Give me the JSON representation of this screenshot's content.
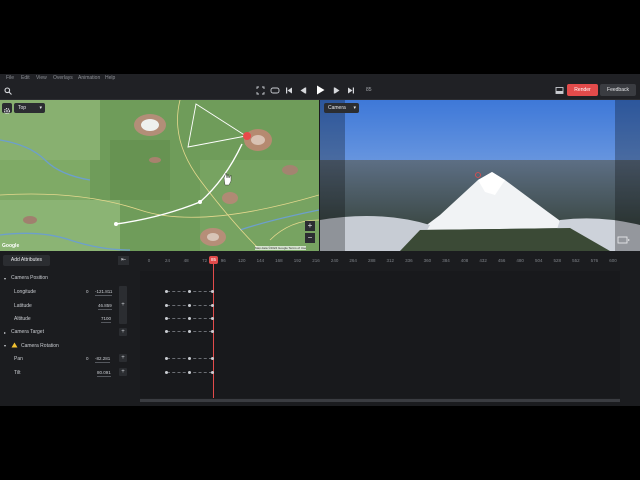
{
  "menu": [
    "File",
    "Edit",
    "View",
    "Overlays",
    "Animation",
    "Help"
  ],
  "toolbar": {
    "frame_counter": "85",
    "render_label": "Render",
    "feedback_label": "Feedback"
  },
  "map_view": {
    "dropdown_label": "Top",
    "attribution": "Map data ©2024 Google  Terms of Use",
    "google_logo": "Google",
    "zoom_in": "+",
    "zoom_out": "−"
  },
  "camera_view": {
    "dropdown_label": "Camera"
  },
  "timeline": {
    "add_attributes_label": "Add Attributes",
    "ruler_ticks": [
      "0",
      "24",
      "48",
      "72",
      "96",
      "120",
      "144",
      "168",
      "192",
      "216",
      "240",
      "264",
      "288",
      "312",
      "336",
      "360",
      "384",
      "408",
      "432",
      "456",
      "480",
      "504",
      "528",
      "552",
      "576",
      "600"
    ],
    "current_frame": "85",
    "groups": {
      "camera_position": "Camera Position",
      "camera_target": "Camera Target",
      "camera_rotation": "Camera Rotation"
    },
    "rows": {
      "longitude_label": "Longitude",
      "longitude_value": "-121.811",
      "longitude_prefix": "0",
      "latitude_label": "Latitude",
      "latitude_value": "46.859",
      "altitude_label": "Altitude",
      "altitude_value": "7100",
      "pan_label": "Pan",
      "pan_value": "-82.281",
      "pan_prefix": "0",
      "tilt_label": "Tilt",
      "tilt_value": "80.091"
    }
  },
  "colors": {
    "accent": "#e24b4b",
    "panel": "#1b1c1f",
    "toolbar": "#202125"
  },
  "icons": [
    "search-icon",
    "fullscreen-icon",
    "loop-icon",
    "skip-start-icon",
    "step-back-icon",
    "play-icon",
    "step-forward-icon",
    "skip-end-icon",
    "frame-icon",
    "gear-icon",
    "collapse-icon",
    "warning-icon",
    "plus-icon"
  ]
}
